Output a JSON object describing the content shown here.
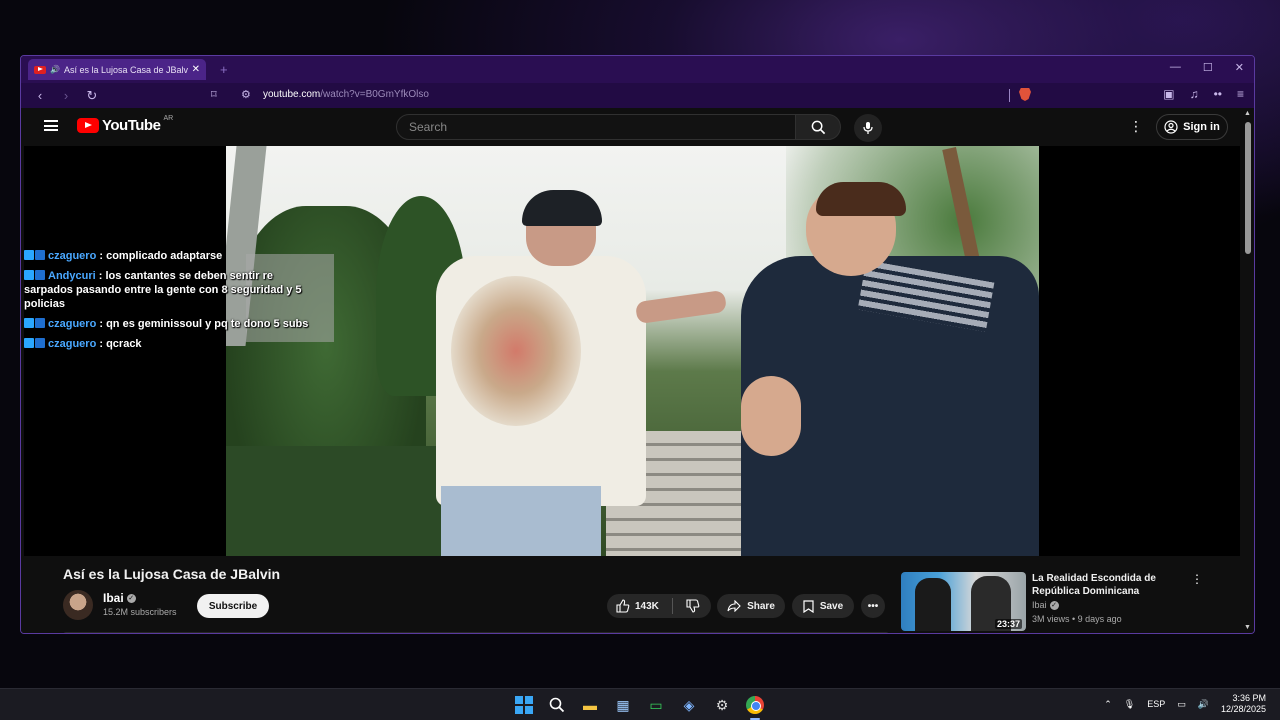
{
  "browser": {
    "tab_title": "Así es la Lujosa Casa de JBalvin",
    "url_host": "youtube.com",
    "url_path": "/watch?v=B0GmYfkOlso"
  },
  "youtube": {
    "logo_text": "YouTube",
    "country_code": "AR",
    "search_placeholder": "Search",
    "sign_in_label": "Sign in"
  },
  "chat": {
    "messages": [
      {
        "user": "czaguero",
        "text": ": complicado adaptarse"
      },
      {
        "user": "Andycuri",
        "text": ": los cantantes se deben sentir re sarpados pasando entre la gente con 8 seguridad y 5 policias"
      },
      {
        "user": "czaguero",
        "text": ": qn es geminissoul y pq te dono 5 subs"
      },
      {
        "user": "czaguero",
        "text": ": qcrack"
      }
    ]
  },
  "video": {
    "title": "Así es la Lujosa Casa de JBalvin",
    "channel": "Ibai",
    "subscribers": "15.2M subscribers",
    "subscribe_label": "Subscribe",
    "likes": "143K",
    "share_label": "Share",
    "save_label": "Save"
  },
  "recommendation": {
    "title": "La Realidad Escondida de República Dominicana",
    "channel": "Ibai",
    "meta": "3M views • 9 days ago",
    "duration": "23:37"
  },
  "taskbar": {
    "language": "ESP",
    "time": "3:36 PM",
    "date": "12/28/2025"
  },
  "colors": {
    "tab_bar": "#2a0e52",
    "youtube_red": "#ff0000",
    "chat_username": "#4aa8ff"
  }
}
